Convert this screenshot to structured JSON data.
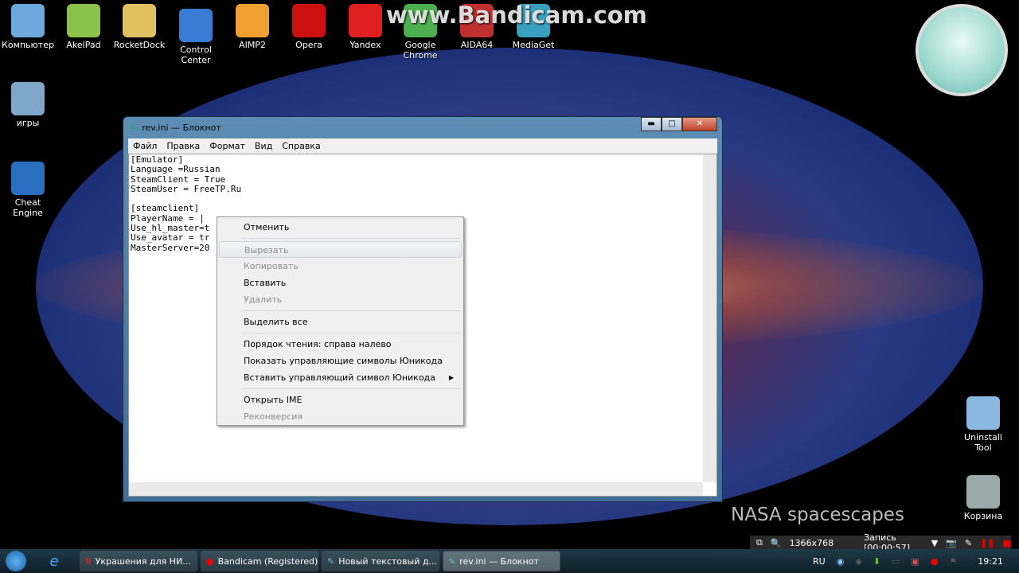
{
  "watermark": "www.Bandicam.com",
  "desktop_icons": [
    {
      "label": "Компьютер",
      "color": "#6fa8dc"
    },
    {
      "label": "AkelPad",
      "color": "#8bc34a"
    },
    {
      "label": "RocketDock",
      "color": "#e0c060"
    },
    {
      "label": "Control Center",
      "color": "#3a7bd5"
    },
    {
      "label": "AIMP2",
      "color": "#f0a030"
    },
    {
      "label": "Opera",
      "color": "#cc1010"
    },
    {
      "label": "Yandex",
      "color": "#e02020"
    },
    {
      "label": "Google Chrome",
      "color": "#4caf50"
    },
    {
      "label": "AIDA64",
      "color": "#c03030"
    },
    {
      "label": "MediaGet",
      "color": "#3aa0c0"
    },
    {
      "label": "игры",
      "color": "#7fa7c9"
    },
    {
      "label": "Cheat Engine",
      "color": "#2a6fbf"
    },
    {
      "label": "Uninstall Tool",
      "color": "#8ab8e0"
    },
    {
      "label": "Корзина",
      "color": "#9aa"
    }
  ],
  "wallpaper_caption": "NASA spacescapes",
  "notepad": {
    "title": "rev.ini — Блокнот",
    "controls": {
      "minimize": "▬",
      "maximize": "□",
      "close": "✕"
    },
    "menu": [
      "Файл",
      "Правка",
      "Формат",
      "Вид",
      "Справка"
    ],
    "content": "[Emulator]\nLanguage =Russian\nSteamClient = True\nSteamUser = FreeTP.Ru\n\n[steamclient]\nPlayerName = |\nUse_hl_master=t\nUse_avatar = tr\nMasterServer=20"
  },
  "context_menu": {
    "items": [
      {
        "label": "Отменить",
        "enabled": true
      },
      {
        "separator": true
      },
      {
        "label": "Вырезать",
        "enabled": false,
        "highlighted": true
      },
      {
        "label": "Копировать",
        "enabled": false
      },
      {
        "label": "Вставить",
        "enabled": true
      },
      {
        "label": "Удалить",
        "enabled": false
      },
      {
        "separator": true
      },
      {
        "label": "Выделить все",
        "enabled": true
      },
      {
        "separator": true
      },
      {
        "label": "Порядок чтения: справа налево",
        "enabled": true
      },
      {
        "label": "Показать управляющие символы Юникода",
        "enabled": true
      },
      {
        "label": "Вставить управляющий символ Юникода",
        "enabled": true,
        "submenu": true
      },
      {
        "separator": true
      },
      {
        "label": "Открыть IME",
        "enabled": true
      },
      {
        "label": "Реконверсия",
        "enabled": false
      }
    ]
  },
  "bandicam_bar": {
    "resolution": "1366x768",
    "status": "Запись [00:00:57]"
  },
  "taskbar": {
    "items": [
      {
        "label": "Украшения для НИ...",
        "icon": "yandex-icon",
        "active": false
      },
      {
        "label": "Bandicam (Registered)",
        "icon": "record-icon",
        "active": false
      },
      {
        "label": "Новый текстовый д...",
        "icon": "notepad-icon",
        "active": false
      },
      {
        "label": "rev.ini — Блокнот",
        "icon": "notepad-icon",
        "active": true
      }
    ],
    "language": "RU",
    "clock": "19:21"
  }
}
